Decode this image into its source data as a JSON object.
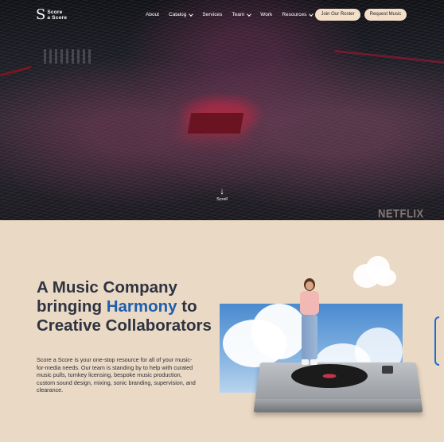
{
  "brand": {
    "mark": "S",
    "line1": "Score",
    "line2": "a Score"
  },
  "nav": {
    "items": [
      {
        "label": "About",
        "has_dropdown": false
      },
      {
        "label": "Catalog",
        "has_dropdown": true
      },
      {
        "label": "Services",
        "has_dropdown": false
      },
      {
        "label": "Team",
        "has_dropdown": true
      },
      {
        "label": "Work",
        "has_dropdown": false
      },
      {
        "label": "Resources",
        "has_dropdown": true
      }
    ],
    "join_button": "Join Our Roster",
    "request_button": "Request Music"
  },
  "hero": {
    "scroll_label": "Scroll",
    "watermark": "NETFLIX",
    "icons": {
      "scroll": "arrow-down-icon",
      "dropdown": "chevron-down-icon"
    }
  },
  "intro": {
    "headline_part1": "A Music Company bringing ",
    "headline_accent": "Harmony",
    "headline_part2": " to Creative Collaborators",
    "description": "Score a Score is your one-stop resource for all of your music-for-media needs. Our team is standing by to help with curated music pulls, turnkey licensing, bespoke music production, custom sound design, mixing, sonic branding, supervision, and clearance."
  },
  "colors": {
    "page_background": "#ead9c4",
    "headline": "#2d3340",
    "accent": "#1d5fae",
    "button_background": "#f3dfc9",
    "hero_overlay": "#1b1d24"
  }
}
